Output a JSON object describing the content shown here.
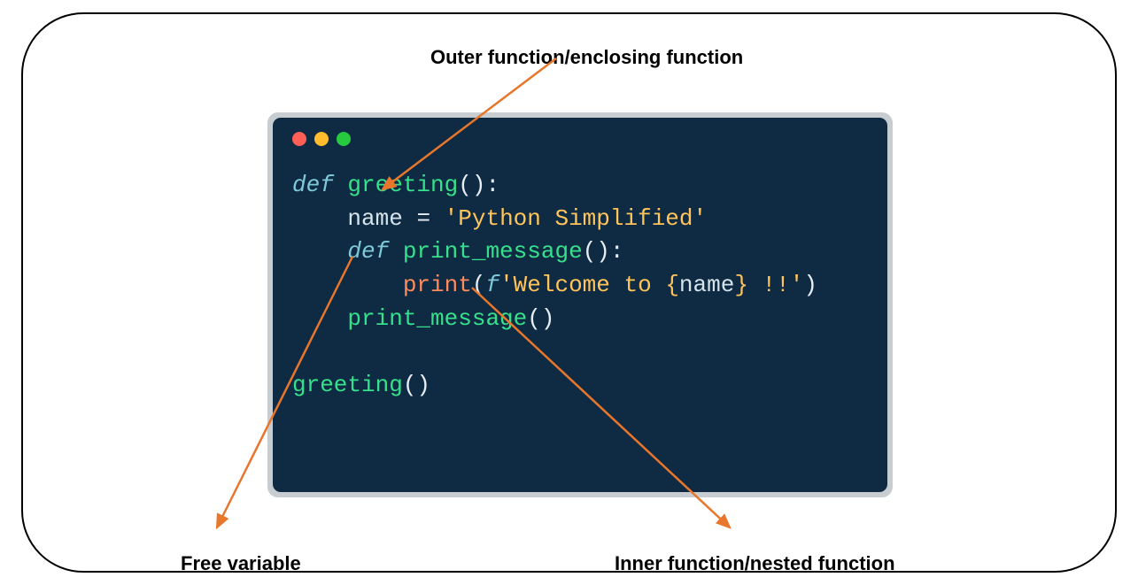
{
  "labels": {
    "top": "Outer function/enclosing function",
    "left": "Free variable",
    "right": "Inner function/nested function"
  },
  "code": {
    "line1": {
      "def": "def",
      "name": "greeting",
      "paren": "():"
    },
    "line2": {
      "indent": "    ",
      "var": "name",
      "eq": " = ",
      "str": "'Python Simplified'"
    },
    "line3": {
      "indent": "    ",
      "def": "def",
      "name": "print_message",
      "paren": "():"
    },
    "line4": {
      "indent": "        ",
      "print": "print",
      "open": "(",
      "f": "f",
      "qopen": "'",
      "s1": "Welcome to ",
      "lb": "{",
      "v": "name",
      "rb": "}",
      "s2": " !!",
      "qclose": "'",
      "close": ")"
    },
    "line5": {
      "indent": "    ",
      "call": "print_message",
      "paren": "()"
    },
    "line6": "",
    "line7": {
      "call": "greeting",
      "paren": "()"
    }
  },
  "arrow_color": "#E8762B"
}
